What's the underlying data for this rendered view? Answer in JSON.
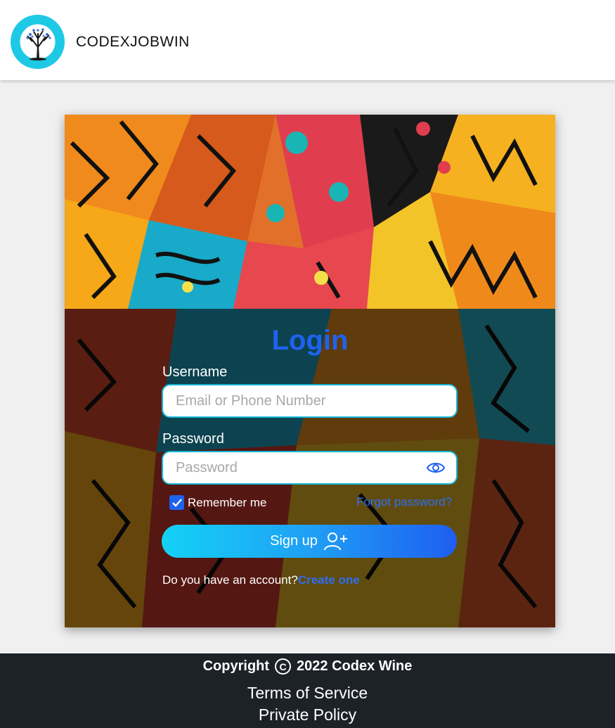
{
  "header": {
    "brand": "CODEXJOBWIN",
    "logo_icon": "tree-logo-icon",
    "logo_bg": "#1ec9e6"
  },
  "login": {
    "title": "Login",
    "username_label": "Username",
    "username_placeholder": "Email or Phone Number",
    "password_label": "Password",
    "password_placeholder": "Password",
    "show_password_icon": "eye-icon",
    "remember_label": "Remember me",
    "remember_checked": true,
    "forgot_label": "Forgot password?",
    "submit_label": "Sign up",
    "submit_icon": "user-plus-icon",
    "account_prompt": "Do you have an account?",
    "create_label": "Create one"
  },
  "footer": {
    "copyright_prefix": "Copyright",
    "copyright_suffix": "2022 Codex Wine",
    "terms": "Terms of Service",
    "privacy": "Private Policy"
  },
  "colors": {
    "accent": "#1f62f0",
    "input_border": "#17b6d6",
    "footer_bg": "#1d2128"
  }
}
